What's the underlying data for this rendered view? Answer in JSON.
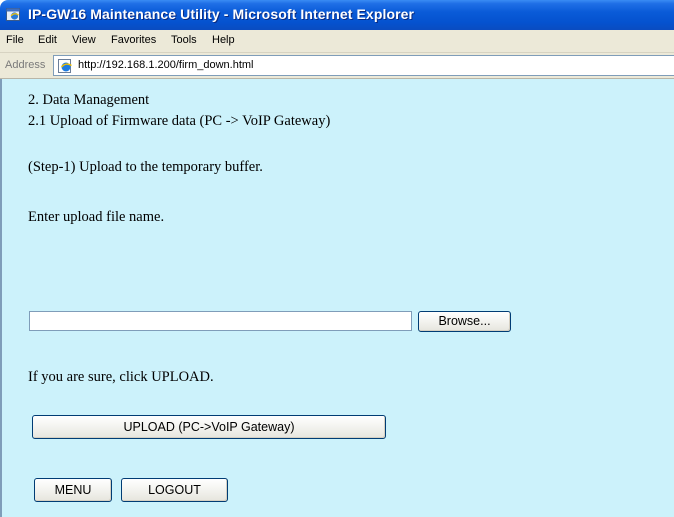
{
  "window": {
    "title": "IP-GW16 Maintenance Utility - Microsoft Internet Explorer"
  },
  "menu": {
    "items": [
      "File",
      "Edit",
      "View",
      "Favorites",
      "Tools",
      "Help"
    ]
  },
  "address": {
    "label": "Address",
    "url": "http://192.168.1.200/firm_down.html"
  },
  "content": {
    "heading": "2. Data Management",
    "subheading": "2.1 Upload of Firmware data (PC -> VoIP Gateway)",
    "step": "(Step-1) Upload to the temporary buffer.",
    "instruction": "Enter upload file name.",
    "file_value": "",
    "browse_label": "Browse...",
    "confirm_text": "If you are sure, click UPLOAD.",
    "upload_label": "UPLOAD (PC->VoIP Gateway)",
    "menu_label": "MENU",
    "logout_label": "LOGOUT"
  },
  "colors": {
    "titlebar": "#0552cf",
    "chrome": "#ece9d8",
    "content_bg": "#ccf2fb"
  }
}
